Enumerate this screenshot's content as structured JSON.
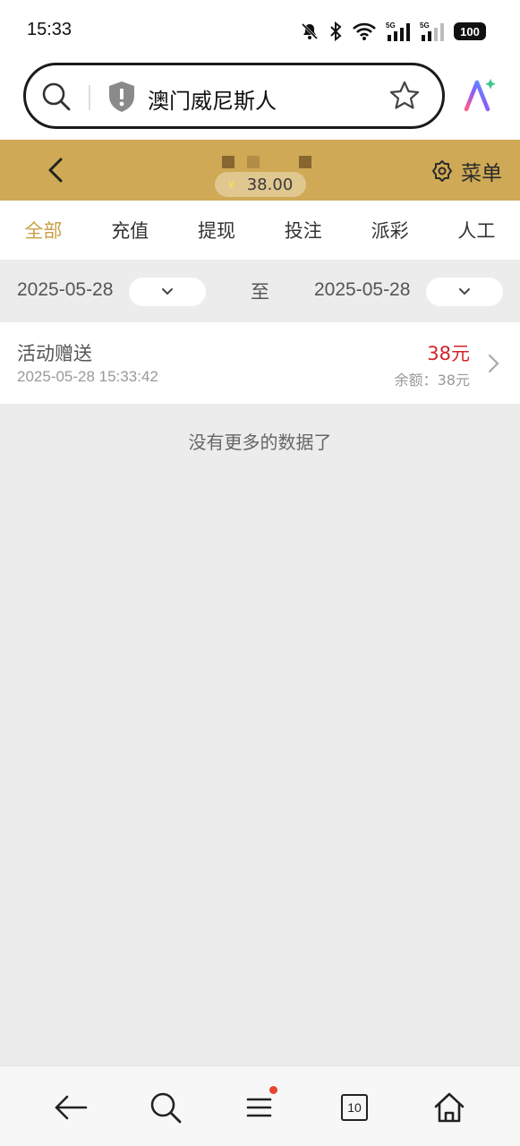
{
  "status_bar": {
    "time": "15:33",
    "battery": "100",
    "signal_labels": [
      "5G",
      "5G"
    ]
  },
  "browser": {
    "query": "澳门威尼斯人",
    "icons": [
      "search-icon",
      "shield-warning-icon",
      "star-icon",
      "ai-assistant-icon"
    ]
  },
  "header": {
    "balance": "38.00",
    "currency_symbol": "¥",
    "menu_label": "菜单"
  },
  "tabs": [
    {
      "label": "全部",
      "active": true
    },
    {
      "label": "充值",
      "active": false
    },
    {
      "label": "提现",
      "active": false
    },
    {
      "label": "投注",
      "active": false
    },
    {
      "label": "派彩",
      "active": false
    },
    {
      "label": "人工",
      "active": false
    }
  ],
  "date_filter": {
    "start": "2025-05-28",
    "to_label": "至",
    "end": "2025-05-28"
  },
  "records": [
    {
      "title": "活动赠送",
      "time": "2025-05-28 15:33:42",
      "amount": "38元",
      "balance": "余额：38元"
    }
  ],
  "no_more_text": "没有更多的数据了",
  "bottom_nav": {
    "tab_count": "10"
  },
  "colors": {
    "gold": "#cfa955",
    "active_tab": "#c9a046",
    "amount_red": "#d2232a"
  }
}
